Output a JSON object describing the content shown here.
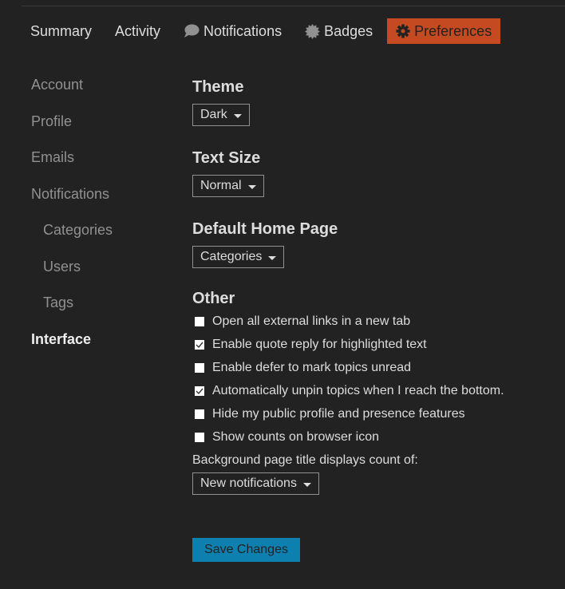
{
  "nav": {
    "tabs": [
      {
        "label": "Summary",
        "icon": null,
        "active": false
      },
      {
        "label": "Activity",
        "icon": null,
        "active": false
      },
      {
        "label": "Notifications",
        "icon": "comment-icon",
        "active": false
      },
      {
        "label": "Badges",
        "icon": "certificate-icon",
        "active": false
      },
      {
        "label": "Preferences",
        "icon": "gear-icon",
        "active": true
      }
    ]
  },
  "sidebar": {
    "items": [
      {
        "label": "Account",
        "sub": false,
        "active": false
      },
      {
        "label": "Profile",
        "sub": false,
        "active": false
      },
      {
        "label": "Emails",
        "sub": false,
        "active": false
      },
      {
        "label": "Notifications",
        "sub": false,
        "active": false
      },
      {
        "label": "Categories",
        "sub": true,
        "active": false
      },
      {
        "label": "Users",
        "sub": true,
        "active": false
      },
      {
        "label": "Tags",
        "sub": true,
        "active": false
      },
      {
        "label": "Interface",
        "sub": false,
        "active": true
      }
    ]
  },
  "main": {
    "theme": {
      "title": "Theme",
      "value": "Dark"
    },
    "text_size": {
      "title": "Text Size",
      "value": "Normal"
    },
    "home_page": {
      "title": "Default Home Page",
      "value": "Categories"
    },
    "other": {
      "title": "Other",
      "options": [
        {
          "label": "Open all external links in a new tab",
          "checked": false
        },
        {
          "label": "Enable quote reply for highlighted text",
          "checked": true
        },
        {
          "label": "Enable defer to mark topics unread",
          "checked": false
        },
        {
          "label": "Automatically unpin topics when I reach the bottom.",
          "checked": true
        },
        {
          "label": "Hide my public profile and presence features",
          "checked": false
        },
        {
          "label": "Show counts on browser icon",
          "checked": false
        }
      ],
      "title_count_label": "Background page title displays count of:",
      "title_count_value": "New notifications"
    },
    "save_label": "Save Changes"
  },
  "colors": {
    "background": "#222222",
    "accent_active_tab": "#c54a22",
    "save_button": "#0e80b0",
    "muted_text": "#919191",
    "text": "#dddddd"
  }
}
